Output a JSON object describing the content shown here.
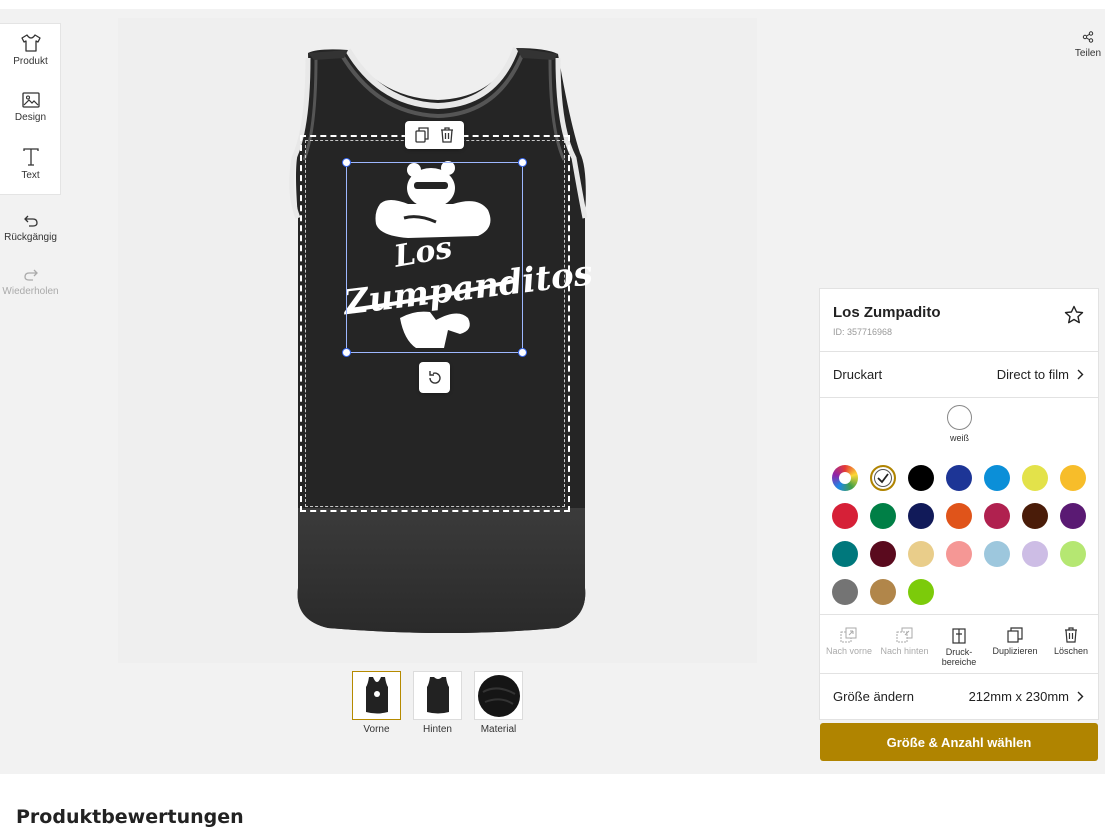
{
  "toolbar": {
    "product_label": "Produkt",
    "design_label": "Design",
    "text_label": "Text",
    "undo_label": "Rückgängig",
    "redo_label": "Wiederholen"
  },
  "share": {
    "label": "Teilen"
  },
  "canvas": {
    "design_text_line1": "Los",
    "design_text_line2": "Zumpanditos"
  },
  "views": [
    {
      "label": "Vorne",
      "selected": true
    },
    {
      "label": "Hinten",
      "selected": false
    },
    {
      "label": "Material",
      "selected": false
    }
  ],
  "panel": {
    "design_title": "Los Zumpadito",
    "design_id": "ID: 357716968",
    "print_type_label": "Druckart",
    "print_type_value": "Direct to film",
    "selected_color_name": "weiß",
    "colors": [
      "multicolor",
      "#ffffff",
      "#000000",
      "#1d3596",
      "#0b8fd8",
      "#e3e24a",
      "#f7bd2a",
      "#d62037",
      "#007f46",
      "#111a59",
      "#e0541a",
      "#b0214f",
      "#4a1c09",
      "#5a1a73",
      "#00787c",
      "#5a0a1e",
      "#e9cd8a",
      "#f59795",
      "#9dc7dd",
      "#cdbde5",
      "#b5e772",
      "#747474",
      "#b1864a",
      "#7ccb0a"
    ],
    "actions": {
      "bring_front": "Nach vorne",
      "send_back": "Nach hinten",
      "print_areas_line1": "Druck-",
      "print_areas_line2": "bereiche",
      "duplicate": "Duplizieren",
      "delete": "Löschen"
    },
    "size_label": "Größe ändern",
    "size_value": "212mm x 230mm"
  },
  "cta_label": "Größe & Anzahl wählen",
  "reviews_heading": "Produktbewertungen"
}
